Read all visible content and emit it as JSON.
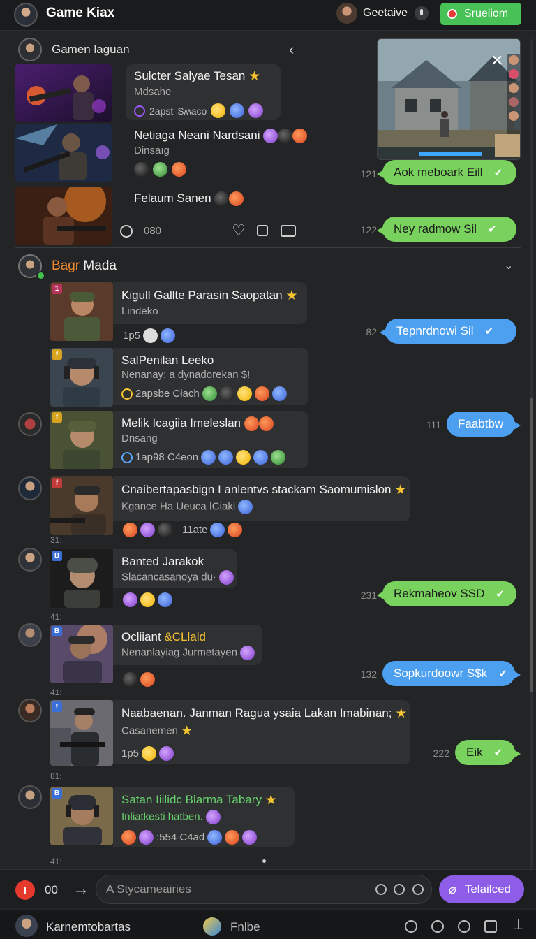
{
  "topbar": {
    "app_title": "Game Kiax",
    "user_name": "Geetaive",
    "stream_button": "Srueiiom",
    "accent": "#48c257"
  },
  "section1": {
    "title": "Gamen laguan",
    "games": [
      {
        "title": "Sulcter Salyae Tesan",
        "sub": "Mdsahe",
        "meta": "2apst",
        "meta2": "Sʍaco"
      },
      {
        "title": "Netiaga Neani Nardsani",
        "sub": "Dinsaıg",
        "meta": "",
        "meta2": ""
      },
      {
        "title": "Felaum Sanen",
        "sub": "",
        "meta": "",
        "meta2": ""
      }
    ],
    "comment_count": "080"
  },
  "right_bubbles_top": [
    {
      "num": "121",
      "text": "Aok meboark Eill"
    },
    {
      "num": "122",
      "text": "Ney radmow Sil"
    }
  ],
  "section2": {
    "title_highlight": "Bagr",
    "title_rest": " Mada"
  },
  "posts": [
    {
      "badge": "1",
      "title": "Kigull Gallte Parasin Saopatan",
      "sub": "Lindeko",
      "meta": "1p5",
      "idx": ""
    },
    {
      "badge": "f",
      "title": "SalPenilan Leeko",
      "sub": "Nenanay; a dynadorekan $!",
      "meta": "2apsbe  Cłach",
      "idx": ""
    },
    {
      "badge": "f",
      "title": "Melik Icagiia Imeleslan",
      "sub": "Dnsang",
      "meta": "1ap98  C4eon",
      "idx": ""
    },
    {
      "badge": "f",
      "title": "Cnaibertapasbign I anlentvs stackam Saomumislon",
      "sub": "Kgance Ha Ueuca ǀCiaki",
      "meta": "11ate",
      "idx": "31:"
    },
    {
      "badge": "B",
      "title": "Banted Jarakok",
      "sub": "Slacancasanoya du·",
      "meta": "",
      "idx": "41:"
    },
    {
      "badge": "B",
      "title": "Ocliiant",
      "title_hl": "&CLlald",
      "sub": "Nenanlayiag Jurmetayen",
      "meta": "",
      "idx": "41:"
    },
    {
      "badge": "t",
      "title": "Naabaenan. Janman Ragua ysaia Lakan Imabinan;",
      "sub": "Casanemen",
      "meta": "1p5",
      "idx": "81:"
    },
    {
      "badge": "B",
      "title": "Satan Iiilidc Blarma Tabary",
      "sub": "Inliatkesti hatben.",
      "meta": ":554  C4ad",
      "idx": "41:"
    }
  ],
  "right_bubbles": [
    {
      "num": "82",
      "text": "Tepnrdnowi Sil",
      "color": "blue"
    },
    {
      "num": "111",
      "text": "Faabtbw",
      "color": "blue"
    },
    {
      "num": "231",
      "text": "Rekmaheov SSD",
      "color": "green"
    },
    {
      "num": "132",
      "text": "Sopkurdoowr S$k",
      "color": "blue"
    },
    {
      "num": "222",
      "text": "Eik",
      "color": "green"
    }
  ],
  "composer": {
    "count": "00",
    "placeholder": "A Stycameairies",
    "attach_label": "Telailced"
  },
  "bottombar": {
    "user": "Karnemtobartas",
    "game": "Fnlbe"
  }
}
